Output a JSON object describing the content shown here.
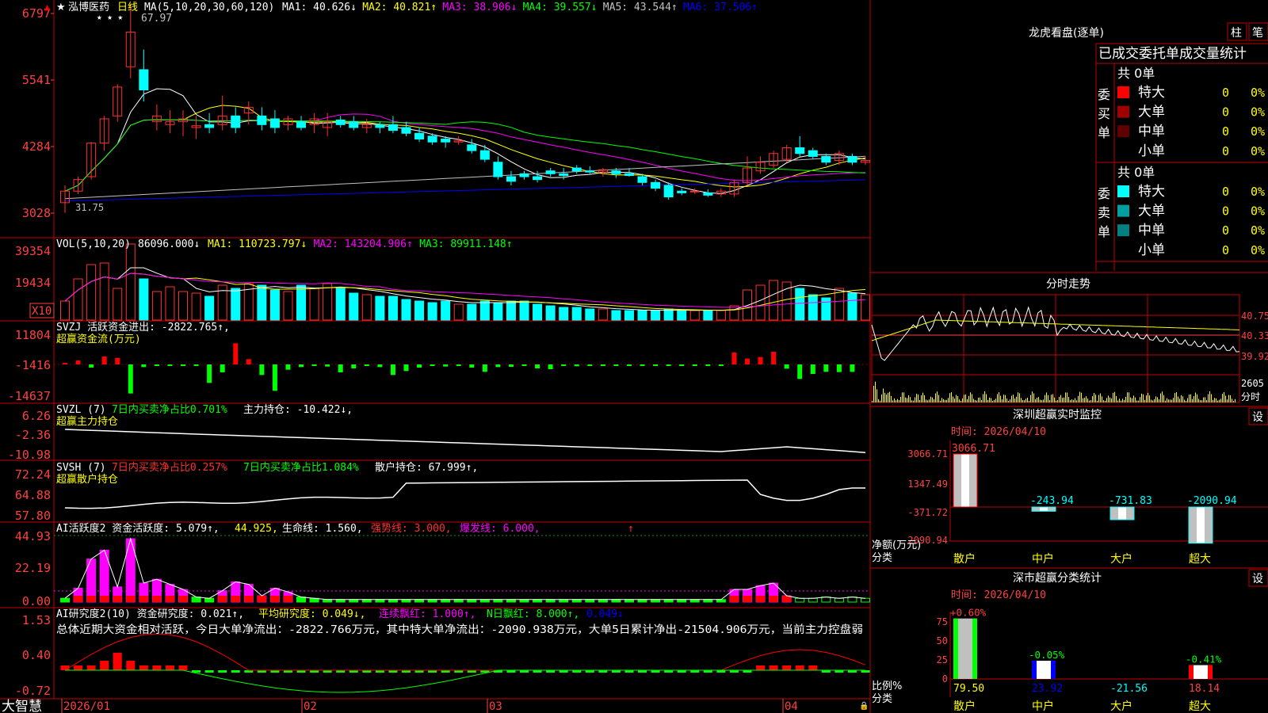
{
  "stock": {
    "name": "泓博医药",
    "period_label": "日线",
    "high_mark": "67.97"
  },
  "colors": {
    "up": "#ff3030",
    "down": "#00ffff",
    "frame": "#c00000",
    "axis_text": "#ff4040",
    "bg": "#000000"
  },
  "main_panel": {
    "ma_header": "MA(5,10,20,30,60,120)",
    "ma_values": [
      {
        "label": "MA1: 40.626",
        "arrow": "↓",
        "color": "#ffffff"
      },
      {
        "label": "MA2: 40.821",
        "arrow": "↑",
        "color": "#ffff00"
      },
      {
        "label": "MA3: 38.906",
        "arrow": "↓",
        "color": "#ff00ff"
      },
      {
        "label": "MA4: 39.557",
        "arrow": "↓",
        "color": "#00ff00"
      },
      {
        "label": "MA5: 43.544",
        "arrow": "↑",
        "color": "#c0c0c0"
      },
      {
        "label": "MA6: 37.506",
        "arrow": "↑",
        "color": "#0000ff"
      }
    ],
    "y_ticks": [
      "6797",
      "5541",
      "4284",
      "3028"
    ],
    "low_mark": "31.75"
  },
  "volume_panel": {
    "header": "VOL(5,10,20)",
    "vol": "86096.000↓",
    "ma_values": [
      {
        "label": "MA1: 110723.797↓",
        "color": "#ffff00"
      },
      {
        "label": "MA2: 143204.906↑",
        "color": "#ff00ff"
      },
      {
        "label": "MA3: 89911.148↑",
        "color": "#00ff00"
      }
    ],
    "y_ticks": [
      "39354",
      "19434"
    ],
    "unit": "X10"
  },
  "svzj_panel": {
    "header": "SVZJ  活跃资金进出: -2822.765↑,",
    "sub": "超赢资金流(万元)",
    "y_ticks": [
      "11804",
      "-1416",
      "-14637"
    ]
  },
  "svzl_panel": {
    "header1": "SVZL (7)",
    "header2": "7日内买卖净占比0.701%",
    "header3": "主力持仓: -10.422↓,",
    "sub": "超赢主力持仓",
    "y_ticks": [
      "6.26",
      "-2.36",
      "-10.98"
    ]
  },
  "svsh_panel": {
    "header1": "SVSH (7)",
    "header2": "7日内买卖净占比0.257%",
    "header3": "7日内买卖净占比1.084%",
    "header4": "散户持仓: 67.999↑,",
    "sub": "超赢散户持仓",
    "y_ticks": [
      "72.24",
      "64.88",
      "57.80"
    ]
  },
  "ai_active_panel": {
    "header": "AI活跃度2 资金活跃度: 5.079↑,",
    "v2": "44.925,",
    "life": "生命线: 1.560,",
    "strong": "强势线: 3.000,",
    "burst": "爆发线: 6.000,",
    "y_ticks": [
      "44.93",
      "22.19",
      "0.00"
    ]
  },
  "ai_research_panel": {
    "header": "AI研究度2(10) 资金研究度: 0.021↑,",
    "avg": "平均研究度: 0.049↓,",
    "consec": "连续飘红: 1.000↑,",
    "nday": "N日飘红: 8.000↑,",
    "last": "0.049↓",
    "summary": "总体近期大资金相对活跃，今日大单净流出：-2822.766万元，其中特大单净流出：-2090.938万元，大单5日累计净出-21504.906万元，当前主力控盘弱",
    "y_ticks": [
      "1.53",
      "0.40",
      "-0.72"
    ]
  },
  "x_axis": {
    "labels": [
      "2026/01",
      "02",
      "03",
      "04"
    ],
    "brand": "大智慧"
  },
  "right_panel": {
    "dragon_title": "龙虎看盘(逐单)",
    "btn_zhu": "柱",
    "btn_bi": "笔",
    "order_title": "已成交委托单成交量统计",
    "buy_label": "委买单",
    "sell_label": "委卖单",
    "buy_total": "共 0单",
    "sell_total": "共 0单",
    "buy_rows": [
      {
        "name": "特大",
        "count": "0",
        "pct": "0%",
        "color": "#ff0000"
      },
      {
        "name": "大单",
        "count": "0",
        "pct": "0%",
        "color": "#a00000"
      },
      {
        "name": "中单",
        "count": "0",
        "pct": "0%",
        "color": "#600000"
      },
      {
        "name": "小单",
        "count": "0",
        "pct": "0%",
        "color": "#000000"
      }
    ],
    "sell_rows": [
      {
        "name": "特大",
        "count": "0",
        "pct": "0%",
        "color": "#00ffff"
      },
      {
        "name": "大单",
        "count": "0",
        "pct": "0%",
        "color": "#00a0a0"
      },
      {
        "name": "中单",
        "count": "0",
        "pct": "0%",
        "color": "#008080"
      },
      {
        "name": "小单",
        "count": "0",
        "pct": "0%",
        "color": "#000000"
      }
    ],
    "intraday_title": "分时走势",
    "intraday_ticks": [
      "40.75",
      "40.33",
      "39.92"
    ],
    "intraday_vol": "2605",
    "intraday_vol_unit": "分时",
    "monitor_title": "深圳超赢实时监控",
    "monitor_set": "设",
    "monitor_time": "时间: 2026/04/10",
    "monitor_ticks": [
      "3066.71",
      "1347.49",
      "-371.72",
      "-2090.94"
    ],
    "monitor_unit1": "净额(万元)",
    "monitor_unit2": "分类",
    "classify_title": "深市超赢分类统计",
    "classify_set": "设",
    "classify_time": "时间: 2026/04/10",
    "classify_ticks": [
      "75",
      "50",
      "25",
      "0"
    ],
    "classify_unit1": "比例%",
    "classify_unit2": "分类"
  },
  "chart_data": [
    {
      "type": "candlestick",
      "title": "泓博医药 日线",
      "y_range": [
        28,
        68
      ],
      "note": "approximate daily OHLC values read from chart",
      "ohlc": [
        [
          33.5,
          36.5,
          31.75,
          35.5
        ],
        [
          35.5,
          38.0,
          35.0,
          37.5
        ],
        [
          38.0,
          44.0,
          37.5,
          43.8
        ],
        [
          43.8,
          48.5,
          42.5,
          48.0
        ],
        [
          48.5,
          54.0,
          47.5,
          53.5
        ],
        [
          57.0,
          67.97,
          55.0,
          63.0
        ],
        [
          56.5,
          60.0,
          51.0,
          53.0
        ],
        [
          47.5,
          50.5,
          46.0,
          48.5
        ],
        [
          47.0,
          49.5,
          45.5,
          47.5
        ],
        [
          47.5,
          49.5,
          45.0,
          48.0
        ],
        [
          46.5,
          48.5,
          44.5,
          46.8
        ],
        [
          47.0,
          49.0,
          45.5,
          46.5
        ],
        [
          47.0,
          52.0,
          46.0,
          48.5
        ],
        [
          48.5,
          50.0,
          45.5,
          46.5
        ],
        [
          49.0,
          51.0,
          47.0,
          50.0
        ],
        [
          48.5,
          50.0,
          46.0,
          47.0
        ],
        [
          48.0,
          49.5,
          45.5,
          46.5
        ],
        [
          47.0,
          48.5,
          46.0,
          48.0
        ],
        [
          47.5,
          48.5,
          46.0,
          46.5
        ],
        [
          47.0,
          49.0,
          45.5,
          48.0
        ],
        [
          46.5,
          49.0,
          45.0,
          47.5
        ],
        [
          47.8,
          48.5,
          46.5,
          47.0
        ],
        [
          47.5,
          48.5,
          46.0,
          46.5
        ],
        [
          46.5,
          48.0,
          45.5,
          47.0
        ],
        [
          47.0,
          47.5,
          45.5,
          46.5
        ],
        [
          47.0,
          48.5,
          45.5,
          46.0
        ],
        [
          46.5,
          47.5,
          45.0,
          45.5
        ],
        [
          45.5,
          46.5,
          44.0,
          44.5
        ],
        [
          45.0,
          45.5,
          43.5,
          44.0
        ],
        [
          44.5,
          45.0,
          43.0,
          44.0
        ],
        [
          44.0,
          45.0,
          43.5,
          44.2
        ],
        [
          43.5,
          44.5,
          42.0,
          42.5
        ],
        [
          42.5,
          43.5,
          40.5,
          41.0
        ],
        [
          40.5,
          41.5,
          37.5,
          38.0
        ],
        [
          38.0,
          39.0,
          36.5,
          37.2
        ],
        [
          38.5,
          39.0,
          37.5,
          38.0
        ],
        [
          38.0,
          39.0,
          37.0,
          37.5
        ],
        [
          39.0,
          39.5,
          38.0,
          38.5
        ],
        [
          38.5,
          39.5,
          37.5,
          38.2
        ],
        [
          39.5,
          40.0,
          38.5,
          39.0
        ],
        [
          39.0,
          39.8,
          38.5,
          38.8
        ],
        [
          38.8,
          39.5,
          38.0,
          39.2
        ],
        [
          39.0,
          39.5,
          37.8,
          38.5
        ],
        [
          38.5,
          39.5,
          38.0,
          38.2
        ],
        [
          38.0,
          38.5,
          36.5,
          37.0
        ],
        [
          37.0,
          37.5,
          35.5,
          36.0
        ],
        [
          36.5,
          37.0,
          34.0,
          34.5
        ],
        [
          35.5,
          36.0,
          34.8,
          35.2
        ],
        [
          35.5,
          36.0,
          35.0,
          35.5
        ],
        [
          35.2,
          35.8,
          34.5,
          34.8
        ],
        [
          35.0,
          36.0,
          34.5,
          35.5
        ],
        [
          35.0,
          37.5,
          34.5,
          37.0
        ],
        [
          37.0,
          41.5,
          36.5,
          39.5
        ],
        [
          39.0,
          41.5,
          38.5,
          40.5
        ],
        [
          40.0,
          42.5,
          39.5,
          42.0
        ],
        [
          41.0,
          43.5,
          40.5,
          43.0
        ],
        [
          43.0,
          45.0,
          41.5,
          42.0
        ],
        [
          42.5,
          43.0,
          41.0,
          41.5
        ],
        [
          41.5,
          42.0,
          40.0,
          40.5
        ],
        [
          40.8,
          42.5,
          40.0,
          42.0
        ],
        [
          41.5,
          42.0,
          40.0,
          40.5
        ],
        [
          40.5,
          41.5,
          40.0,
          40.8
        ]
      ]
    },
    {
      "type": "bar",
      "title": "VOL(5,10,20)",
      "values": [
        12000,
        26000,
        35000,
        36000,
        20000,
        48000,
        26000,
        18000,
        21000,
        18000,
        17000,
        15000,
        22000,
        20000,
        23000,
        22000,
        19000,
        18000,
        22000,
        20000,
        23000,
        20000,
        17000,
        16000,
        15000,
        15000,
        13000,
        12000,
        11000,
        12000,
        10000,
        10000,
        12000,
        11000,
        12000,
        12000,
        10000,
        9000,
        8000,
        8000,
        7000,
        7000,
        6000,
        6000,
        6000,
        6000,
        7000,
        6000,
        6000,
        6000,
        6000,
        9000,
        19000,
        22000,
        25000,
        24000,
        20000,
        16000,
        14000,
        20000,
        17000,
        16000
      ]
    },
    {
      "type": "bar",
      "title": "超赢资金流(万元)",
      "values": [
        0,
        1500,
        -1200,
        3000,
        2500,
        -11000,
        -1000,
        -600,
        -300,
        -100,
        -200,
        -7000,
        -3000,
        8000,
        2000,
        -4000,
        -10000,
        -2000,
        -1000,
        -500,
        -800,
        -3000,
        -1500,
        -600,
        -1000,
        -4000,
        -2500,
        -1200,
        -400,
        -800,
        -300,
        -1200,
        -2800,
        -1000,
        -900,
        -400,
        -1500,
        -1800,
        -300,
        -700,
        -200,
        -200,
        -150,
        -150,
        -200,
        -150,
        -100,
        -100,
        -100,
        -100,
        -100,
        4500,
        2200,
        2800,
        4800,
        -1600,
        -5500,
        -3600,
        -2800,
        -2900,
        -2822.765
      ]
    }
  ]
}
